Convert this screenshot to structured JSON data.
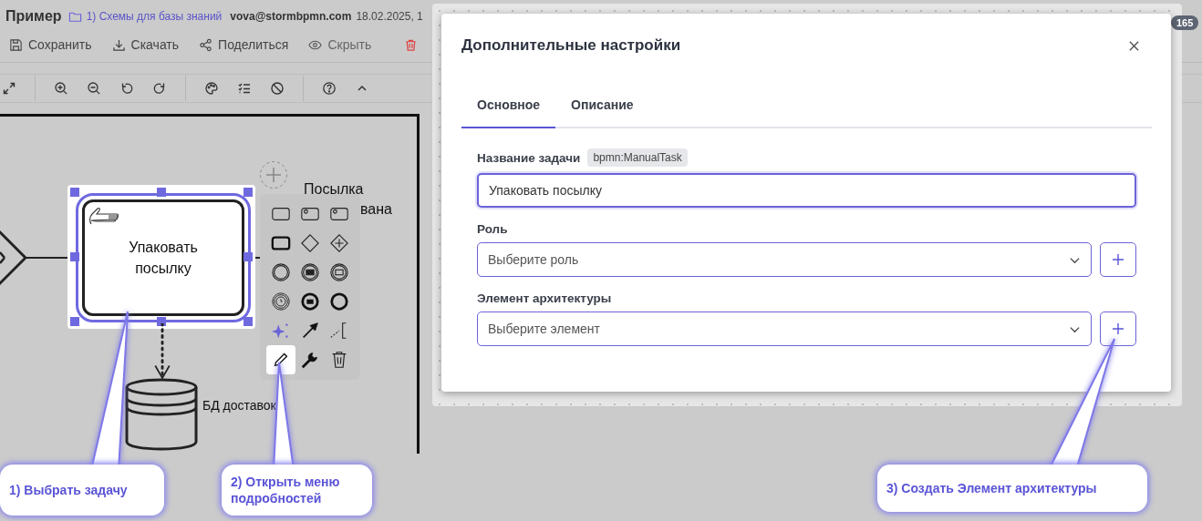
{
  "header": {
    "title": "Пример",
    "folder": "1) Схемы для базы знаний",
    "user": "vova@stormbpmn.com",
    "date": "18.02.2025, 1"
  },
  "actions": [
    {
      "kind": "save",
      "label": "Сохранить"
    },
    {
      "kind": "download",
      "label": "Скачать"
    },
    {
      "kind": "share",
      "label": "Поделиться"
    },
    {
      "kind": "hide",
      "label": "Скрыть"
    },
    {
      "kind": "delete"
    }
  ],
  "notifications": {
    "count": "165"
  },
  "diagram": {
    "task": {
      "label": "Упаковать посылку",
      "selected": true
    },
    "event_label": [
      "Посылка",
      "вана"
    ],
    "datastore": "БД доставок",
    "context_pad": [
      {
        "kind": "task",
        "selected": false
      },
      {
        "kind": "user-task",
        "selected": false
      },
      {
        "kind": "service-task",
        "selected": false
      },
      {
        "kind": "call-activity",
        "selected": false
      },
      {
        "kind": "gateway",
        "selected": false
      },
      {
        "kind": "parallel-gateway",
        "selected": false
      },
      {
        "kind": "intermediate-event",
        "selected": false
      },
      {
        "kind": "message-catch",
        "selected": false
      },
      {
        "kind": "message-throw",
        "selected": false
      },
      {
        "kind": "timer-event",
        "selected": false
      },
      {
        "kind": "message-end",
        "selected": false
      },
      {
        "kind": "end-event",
        "selected": false
      },
      {
        "kind": "sparkle",
        "selected": false
      },
      {
        "kind": "connect",
        "selected": false
      },
      {
        "kind": "annotation",
        "selected": false
      },
      {
        "kind": "edit",
        "selected": true
      },
      {
        "kind": "wrench",
        "selected": false
      },
      {
        "kind": "delete",
        "selected": false
      }
    ]
  },
  "dialog": {
    "title": "Дополнительные настройки",
    "tabs": [
      {
        "label": "Основное",
        "selected": true
      },
      {
        "label": "Описание",
        "selected": false
      }
    ],
    "task_name": {
      "label": "Название задачи",
      "tag": "bpmn:ManualTask",
      "value": "Упаковать посылку"
    },
    "role": {
      "label": "Роль",
      "placeholder": "Выберите роль"
    },
    "element": {
      "label": "Элемент архитектуры",
      "placeholder": "Выберите элемент"
    }
  },
  "callouts": [
    {
      "text": "1) Выбрать задачу"
    },
    {
      "text": "2) Открыть меню подробностей"
    },
    {
      "text": "3) Создать Элемент архитектуры"
    }
  ]
}
